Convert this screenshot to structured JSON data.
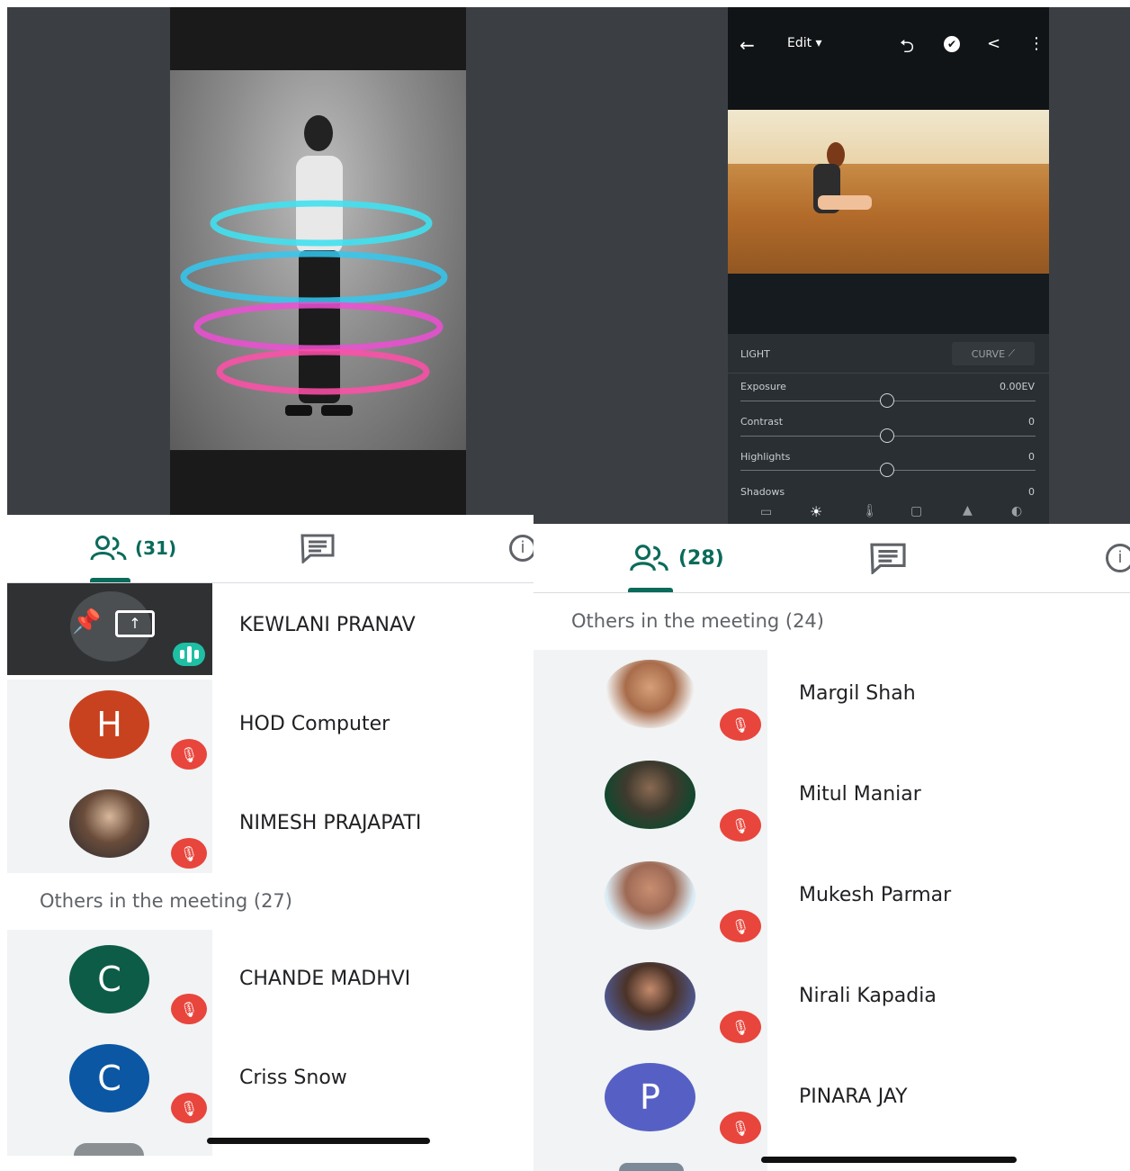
{
  "editor": {
    "edit_label": "Edit ▾",
    "panel_title": "LIGHT",
    "curve_label": "CURVE",
    "sliders": [
      {
        "label": "Exposure",
        "value": "0.00EV"
      },
      {
        "label": "Contrast",
        "value": "0"
      },
      {
        "label": "Highlights",
        "value": "0"
      },
      {
        "label": "Shadows",
        "value": "0"
      }
    ]
  },
  "left_meet": {
    "people_count": "(31)",
    "pinned": {
      "name": "KEWLANI PRANAV"
    },
    "participants": [
      {
        "name": "HOD Computer",
        "initial": "H",
        "color": "#c9421f"
      },
      {
        "name": "NIMESH PRAJAPATI"
      }
    ],
    "section_title": "Others in the meeting (27)",
    "others": [
      {
        "name": "CHANDE MADHVI",
        "initial": "C",
        "color": "#0d5c47"
      },
      {
        "name": "Criss Snow",
        "initial": "C",
        "color": "#0b57a4"
      }
    ]
  },
  "right_meet": {
    "people_count": "(28)",
    "section_title": "Others in the meeting (24)",
    "others": [
      {
        "name": "Margil Shah"
      },
      {
        "name": "Mitul Maniar"
      },
      {
        "name": "Mukesh Parmar"
      },
      {
        "name": "Nirali Kapadia"
      },
      {
        "name": "PINARA JAY",
        "initial": "P",
        "color": "#5660c4"
      }
    ]
  },
  "colors": {
    "accent": "#0b6b5b",
    "mute_red": "#e8453c"
  }
}
